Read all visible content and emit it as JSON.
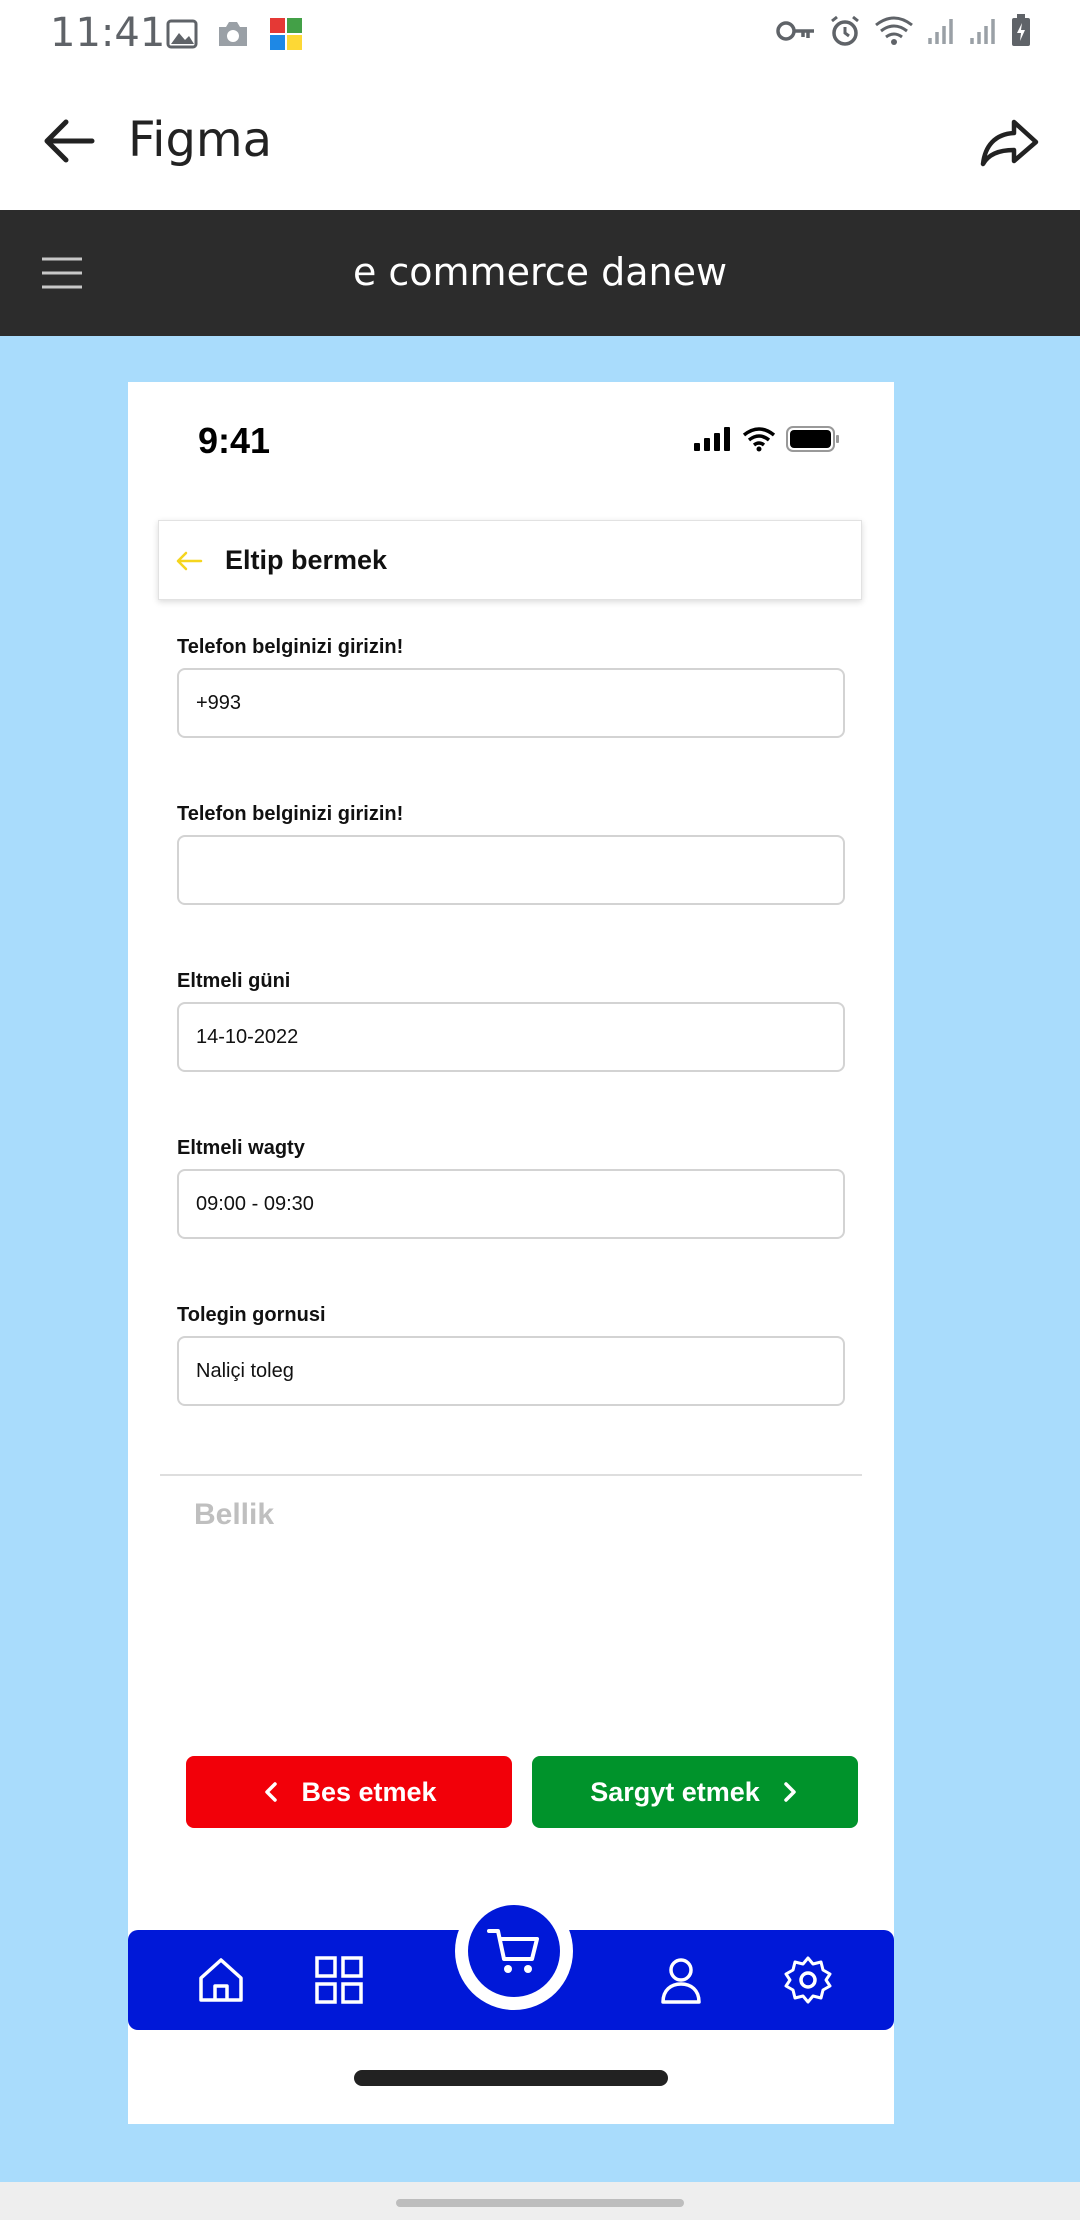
{
  "system_status": {
    "time": "11:41"
  },
  "app_bar": {
    "title": "Figma"
  },
  "prototype_bar": {
    "title": "e commerce danew"
  },
  "phone": {
    "status_time": "9:41",
    "header_title": "Eltip bermek",
    "accent_color": "#f5d51e",
    "fields": [
      {
        "label": "Telefon belginizi girizin!",
        "value": "+993"
      },
      {
        "label": "Telefon belginizi girizin!",
        "value": ""
      },
      {
        "label": "Eltmeli güni",
        "value": "14-10-2022"
      },
      {
        "label": "Eltmeli wagty",
        "value": "09:00 - 09:30"
      },
      {
        "label": "Tolegin gornusi",
        "value": "Naliçi toleg"
      }
    ],
    "note_placeholder": "Bellik",
    "buttons": {
      "cancel_label": "Bes etmek",
      "cancel_color": "#f20009",
      "order_label": "Sargyt etmek",
      "order_color": "#00932b"
    },
    "tabbar": {
      "color": "#0018d8",
      "items": [
        "home-icon",
        "grid-icon",
        "cart-icon",
        "user-icon",
        "settings-icon"
      ]
    }
  },
  "canvas_color": "#a9dcfc"
}
